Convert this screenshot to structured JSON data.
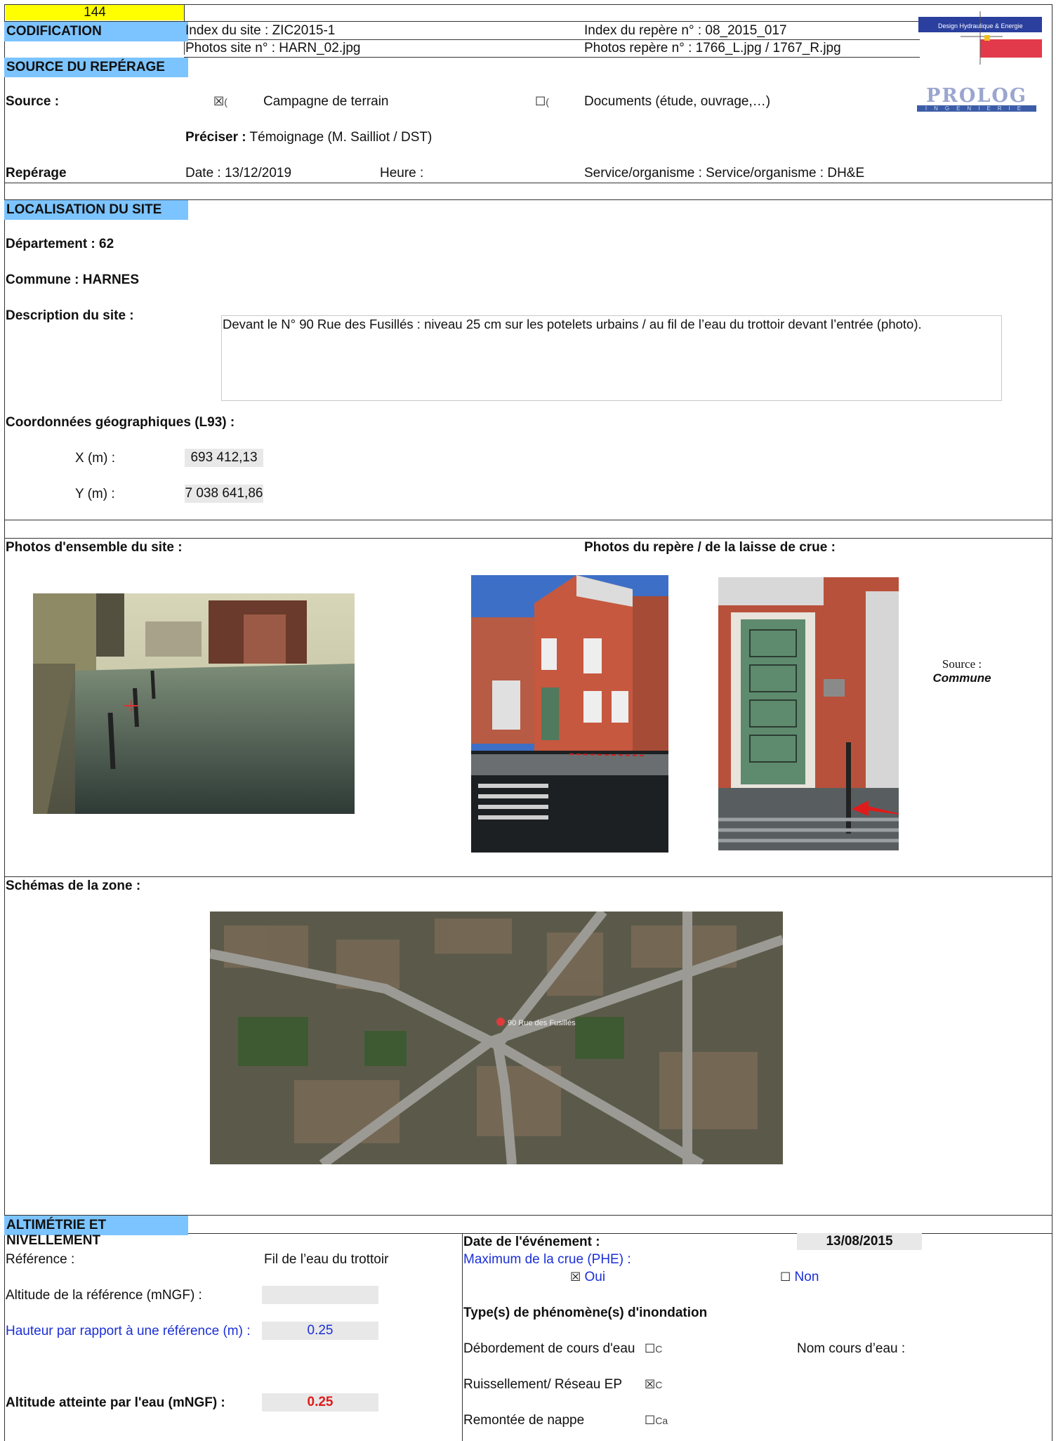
{
  "top_number": "144",
  "codification": {
    "label": "CODIFICATION",
    "site_index": "Index du site :  ZIC2015-1",
    "repere_index": "Index du repère n° : 08_2015_017",
    "site_photos": "Photos site n° : HARN_02.jpg",
    "repere_photos": "Photos repère n° : 1766_L.jpg  / 1767_R.jpg"
  },
  "logos": {
    "dhe_text": "Design Hydraulique & Energie",
    "prolog_text": "PROLOG",
    "prolog_sub": "INGENIERIE"
  },
  "source": {
    "section_title": "SOURCE DU REPÉRAGE",
    "label": "Source :",
    "opt1_box": "☒",
    "opt1_cut": "(",
    "opt1_label": "Campagne de terrain",
    "opt2_box": "☐",
    "opt2_cut": "(",
    "opt2_label": "Documents (étude, ouvrage,…)",
    "preciser_label": "Préciser :",
    "preciser_value": " Témoignage  (M. Sailliot / DST)",
    "reperage_label": "Repérage",
    "date": "Date : 13/12/2019",
    "heure": "Heure :",
    "service": "Service/organisme : Service/organisme : DH&E"
  },
  "localisation": {
    "section_title": "LOCALISATION DU SITE",
    "departement": "Département :  62",
    "commune": "Commune : HARNES",
    "description_label": "Description du site :",
    "description": "Devant le N° 90 Rue des Fusillés : niveau 25 cm sur les potelets urbains / au fil de l’eau du trottoir devant l’entrée (photo).",
    "coords_label": "Coordonnées géographiques (L93) :",
    "x_label": "X (m) :",
    "x_value": "693 412,13",
    "y_label": "Y (m) :",
    "y_value": "7 038 641,86"
  },
  "photos": {
    "ensemble_label": "Photos d'ensemble du site :",
    "repere_label": "Photos du repère / de la laisse de crue  :",
    "source_label": "Source :",
    "source_value": "Commune"
  },
  "schemas": {
    "label": "Schémas de la zone :",
    "map_pin_label": "90 Rue des Fusillés"
  },
  "altimetrie": {
    "section_title": "ALTIMÉTRIE ET NIVELLEMENT",
    "reference_label": "Référence :",
    "reference_value": "Fil de l’eau du trottoir",
    "alt_ref_label": "Altitude de la référence (mNGF)  :",
    "alt_ref_value": "",
    "hauteur_label": "Hauteur par rapport à une référence (m) :",
    "hauteur_value": "0.25",
    "alt_atteinte_label": "Altitude atteinte par l'eau (mNGF) :",
    "alt_atteinte_value": "0.25",
    "date_event_label": "Date de l'événement :",
    "date_event_value": "13/08/2015",
    "phe_label": "Maximum de la crue (PHE) :",
    "oui_box": "☒",
    "oui_label": "Oui",
    "non_box": "☐",
    "non_label": "Non",
    "types_label": "Type(s) de phénomène(s) d'inondation",
    "debordement_label": "Débordement de cours d'eau",
    "debordement_box": "☐",
    "debordement_cut": "C",
    "nom_cours_label": "Nom cours d’eau :",
    "ruissellement_label": "Ruissellement/ Réseau EP",
    "ruissellement_box": "☒",
    "ruissellement_cut": "C",
    "nappe_label": "Remontée de nappe",
    "nappe_box": "☐",
    "nappe_cut": "Ca"
  },
  "colors": {
    "section_bg": "#7cc4ff",
    "top_number_bg": "#ffff00",
    "value_red": "#e01b1b",
    "link_blue": "#1b2fd6"
  }
}
